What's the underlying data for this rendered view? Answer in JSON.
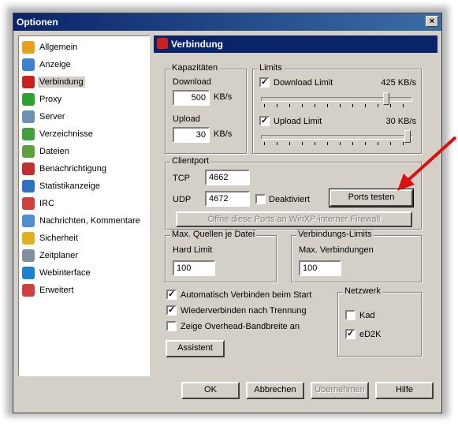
{
  "window": {
    "title": "Optionen",
    "close": "×"
  },
  "nav": {
    "items": [
      {
        "label": "Allgemein",
        "icon": "gear-icon",
        "color": "#e8a020"
      },
      {
        "label": "Anzeige",
        "icon": "monitor-icon",
        "color": "#4080d0"
      },
      {
        "label": "Verbindung",
        "icon": "plug-icon",
        "color": "#cc2020"
      },
      {
        "label": "Proxy",
        "icon": "proxy-icon",
        "color": "#30a030"
      },
      {
        "label": "Server",
        "icon": "server-icon",
        "color": "#7090b0"
      },
      {
        "label": "Verzeichnisse",
        "icon": "folder-icon",
        "color": "#40a040"
      },
      {
        "label": "Dateien",
        "icon": "files-icon",
        "color": "#60a040"
      },
      {
        "label": "Benachrichtigung",
        "icon": "notify-icon",
        "color": "#c03030"
      },
      {
        "label": "Statistikanzeige",
        "icon": "stats-icon",
        "color": "#3070c0"
      },
      {
        "label": "IRC",
        "icon": "irc-icon",
        "color": "#d04040"
      },
      {
        "label": "Nachrichten, Kommentare",
        "icon": "messages-icon",
        "color": "#5090d0"
      },
      {
        "label": "Sicherheit",
        "icon": "lock-icon",
        "color": "#e0b020"
      },
      {
        "label": "Zeitplaner",
        "icon": "calendar-icon",
        "color": "#8090a0"
      },
      {
        "label": "Webinterface",
        "icon": "globe-icon",
        "color": "#2080d0"
      },
      {
        "label": "Erweitert",
        "icon": "advanced-icon",
        "color": "#d04040"
      }
    ],
    "selected_index": 2
  },
  "panel": {
    "title": "Verbindung"
  },
  "capacity": {
    "legend": "Kapazitäten",
    "download_label": "Download",
    "download_value": "500",
    "download_unit": "KB/s",
    "upload_label": "Upload",
    "upload_value": "30",
    "upload_unit": "KB/s"
  },
  "limits": {
    "legend": "Limits",
    "download_limit_label": "Download Limit",
    "download_limit_checked": true,
    "download_limit_value": "425 KB/s",
    "download_slider_level": 0.85,
    "upload_limit_label": "Upload Limit",
    "upload_limit_checked": true,
    "upload_limit_value": "30 KB/s",
    "upload_slider_level": 1.0
  },
  "clientport": {
    "legend": "Clientport",
    "tcp_label": "TCP",
    "tcp_value": "4662",
    "udp_label": "UDP",
    "udp_value": "4672",
    "disabled_label": "Deaktiviert",
    "test_button": "Ports testen",
    "firewall_button": "Öffne diese Ports an WinXP-interner Firewall"
  },
  "max_sources": {
    "legend": "Max. Quellen je Datei",
    "hard_limit_label": "Hard Limit",
    "hard_limit_value": "100"
  },
  "conn_limits": {
    "legend": "Verbindungs-Limits",
    "max_label": "Max. Verbindungen",
    "max_value": "100"
  },
  "options": [
    {
      "label": "Automatisch Verbinden beim Start",
      "checked": true
    },
    {
      "label": "Wiederverbinden nach Trennung",
      "checked": true
    },
    {
      "label": "Zeige Overhead-Bandbreite an",
      "checked": false
    }
  ],
  "assistant_button": "Assistent",
  "network": {
    "legend": "Netzwerk",
    "kad_label": "Kad",
    "kad_checked": false,
    "ed2k_label": "eD2K",
    "ed2k_checked": true
  },
  "footer": {
    "ok": "OK",
    "cancel": "Abbrechen",
    "apply": "Übernehmen",
    "help": "Hilfe"
  },
  "colors": {
    "arrow": "#dd1010",
    "title_bar": "#0a246a"
  },
  "check_mark": "✓"
}
